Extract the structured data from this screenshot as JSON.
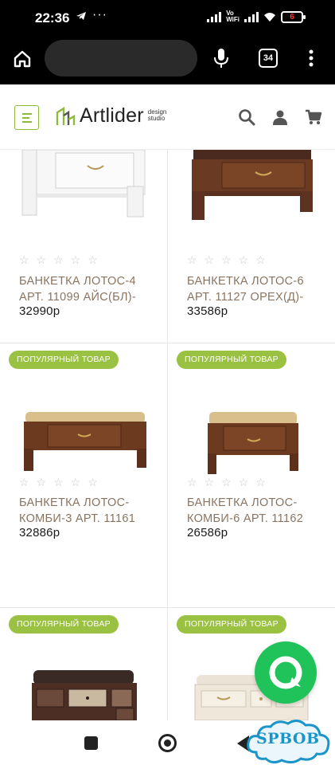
{
  "status_bar": {
    "time": "22:36",
    "network_label": "Vo\nWiFi",
    "battery_level": "6"
  },
  "browser": {
    "tab_count": "34",
    "icons": [
      "home-icon",
      "microphone-icon",
      "tabs-icon",
      "more-vert-icon"
    ]
  },
  "site_header": {
    "logo_text": "Artlider",
    "logo_subtitle_line1": "design",
    "logo_subtitle_line2": "studio",
    "brand_color": "#8dbb3a",
    "icons": [
      "menu-icon",
      "search-icon",
      "user-icon",
      "cart-icon"
    ]
  },
  "products": [
    {
      "badge": "",
      "rating_stars": 0,
      "name_line1": "БАНКЕТКА ЛОТОС-4",
      "name_line2": "АРТ. 11099 АЙС(БЛ)-",
      "price": "32990р",
      "image": "white-bench-with-drawer"
    },
    {
      "badge": "",
      "rating_stars": 0,
      "name_line1": "БАНКЕТКА ЛОТОС-6",
      "name_line2": "АРТ. 11127 ОРЕХ(Д)-",
      "price": "33586р",
      "image": "walnut-bench-with-drawer"
    },
    {
      "badge": "ПОПУЛЯРНЫЙ ТОВАР",
      "rating_stars": 0,
      "name_line1": "БАНКЕТКА ЛОТОС-",
      "name_line2": "КОМБИ-3 АРТ. 11161",
      "price": "32886р",
      "image": "wide-upholstered-bench"
    },
    {
      "badge": "ПОПУЛЯРНЫЙ ТОВАР",
      "rating_stars": 0,
      "name_line1": "БАНКЕТКА ЛОТОС-",
      "name_line2": "КОМБИ-6 АРТ. 11162",
      "price": "26586р",
      "image": "short-upholstered-bench"
    },
    {
      "badge": "ПОПУЛЯРНЫЙ ТОВАР",
      "image": "dark-chest-bench"
    },
    {
      "badge": "ПОПУЛЯРНЫЙ ТОВАР",
      "image": "cream-chest-bench"
    }
  ],
  "chat_widget": {
    "icon": "chat-icon",
    "color": "#1fc35a"
  },
  "bottom_nav": {
    "icons": [
      "recents-icon",
      "home-circle-icon",
      "back-icon"
    ]
  },
  "watermark": {
    "text": "SPBOB"
  },
  "colors": {
    "badge": "#9bc143",
    "product_name": "#8a7460",
    "price": "#1a1a1a"
  }
}
